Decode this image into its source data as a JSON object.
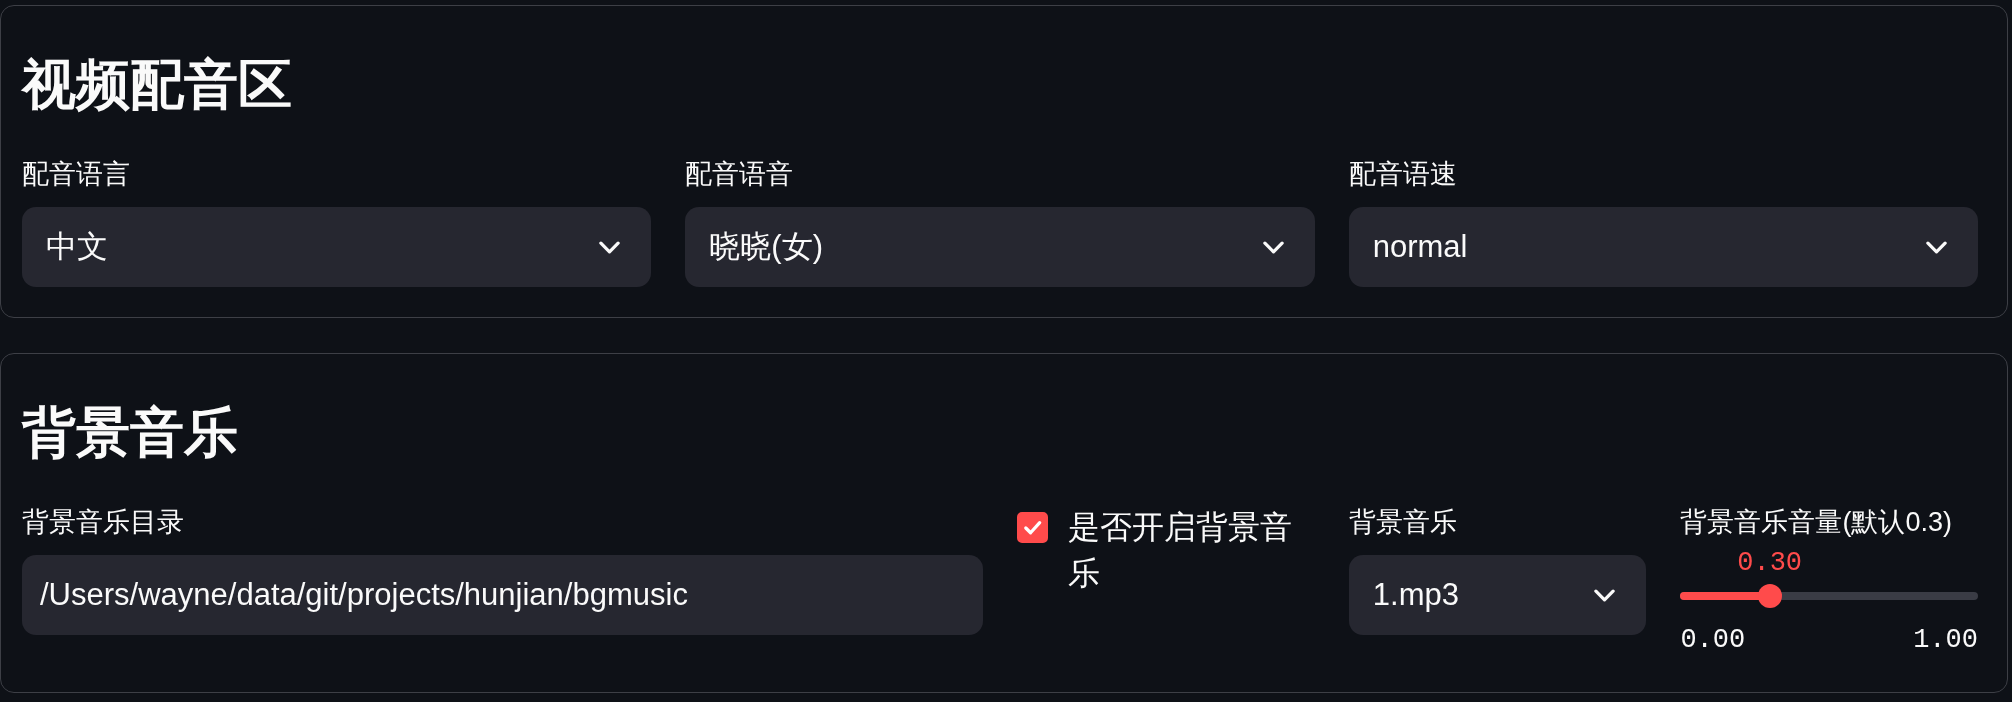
{
  "sections": [
    {
      "title": "视频配音区",
      "fields": [
        {
          "kind": "select",
          "label": "配音语言",
          "value": "中文"
        },
        {
          "kind": "select",
          "label": "配音语音",
          "value": "晓晓(女)"
        },
        {
          "kind": "select",
          "label": "配音语速",
          "value": "normal"
        }
      ]
    },
    {
      "title": "背景音乐",
      "fields": [
        {
          "kind": "text",
          "label": "背景音乐目录",
          "value": "/Users/wayne/data/git/projects/hunjian/bgmusic"
        },
        {
          "kind": "checkbox",
          "label": "是否开启背景音乐",
          "checked": true
        },
        {
          "kind": "select",
          "label": "背景音乐",
          "value": "1.mp3"
        },
        {
          "kind": "slider",
          "label": "背景音乐音量(默认0.3)",
          "reading": "0.30",
          "level": 0.3,
          "min_label": "0.00",
          "max_label": "1.00"
        }
      ]
    }
  ]
}
